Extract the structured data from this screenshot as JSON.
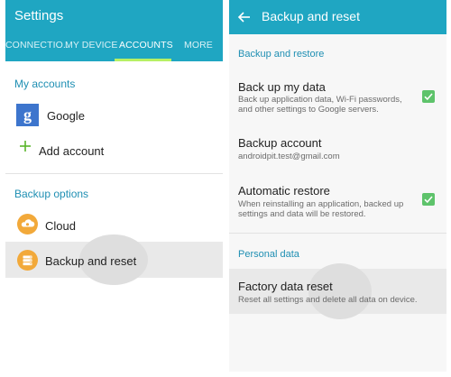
{
  "left": {
    "title": "Settings",
    "tabs": [
      {
        "label": "CONNECTIO.."
      },
      {
        "label": "MY DEVICE"
      },
      {
        "label": "ACCOUNTS"
      },
      {
        "label": "MORE"
      }
    ],
    "active_tab": "ACCOUNTS",
    "my_accounts_header": "My accounts",
    "accounts": [
      {
        "label": "Google",
        "icon": "google-icon"
      },
      {
        "label": "Add account",
        "icon": "plus-icon"
      }
    ],
    "backup_options_header": "Backup options",
    "backup_items": [
      {
        "label": "Cloud",
        "icon": "cloud-icon"
      },
      {
        "label": "Backup and reset",
        "icon": "backup-storage-icon"
      }
    ],
    "google_glyph": "g"
  },
  "right": {
    "title": "Backup and reset",
    "backup_restore_header": "Backup and restore",
    "back_up_my_data": {
      "title": "Back up my data",
      "summary": "Back up application data, Wi-Fi passwords, and other settings to Google servers.",
      "checked": true
    },
    "backup_account": {
      "title": "Backup account",
      "summary": "androidpit.test@gmail.com"
    },
    "automatic_restore": {
      "title": "Automatic restore",
      "summary": "When reinstalling an application, backed up settings and data will be restored.",
      "checked": true
    },
    "personal_data_header": "Personal data",
    "factory_reset": {
      "title": "Factory data reset",
      "summary": "Reset all settings and delete all data on device."
    }
  },
  "colors": {
    "app_bar": "#1fa6c2",
    "tab_indicator": "#b7f064",
    "section_header": "#1f8fb3",
    "checkbox": "#5ec36b",
    "icon_orange": "#f2a93a",
    "google_blue": "#3d75cd"
  }
}
